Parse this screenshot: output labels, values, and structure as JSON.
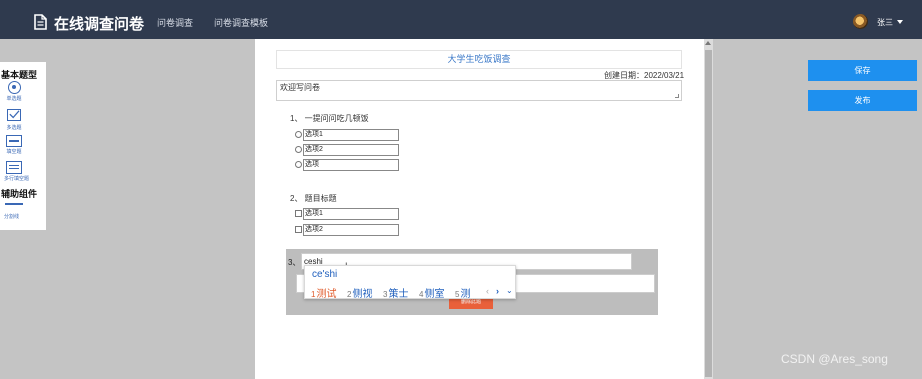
{
  "header": {
    "app_title": "在线调查问卷",
    "nav": [
      "问卷调查",
      "问卷调查模板"
    ],
    "user_name": "张三"
  },
  "palette": {
    "basic_heading": "基本题型",
    "tools": [
      "单选题",
      "多选题",
      "填空题",
      "多行填空题"
    ],
    "aux_heading": "辅助组件",
    "aux_tools": [
      "分割线"
    ]
  },
  "survey": {
    "title": "大学生吃饭调查",
    "create_date": "创建日期：2022/03/21",
    "welcome": "欢迎写问卷",
    "questions": [
      {
        "title": "1、 一提问问吃几顿饭",
        "options": [
          "选项1",
          "选项2",
          "选项"
        ]
      },
      {
        "title": "2、 题目标题",
        "options": [
          "选项1",
          "选项2"
        ]
      },
      {
        "number": "3、",
        "input_value": "ceshi",
        "delete_label": "删除此题"
      }
    ]
  },
  "ime": {
    "pinyin": "ce'shi",
    "candidates": [
      {
        "n": "1",
        "text": "测试"
      },
      {
        "n": "2",
        "text": "侧视"
      },
      {
        "n": "3",
        "text": "策士"
      },
      {
        "n": "4",
        "text": "侧室"
      },
      {
        "n": "5",
        "text": "测"
      }
    ],
    "prev": "‹",
    "next": "›",
    "expand": "⌄"
  },
  "actions": {
    "save": "保存",
    "publish": "发布"
  },
  "watermark": "CSDN @Ares_song",
  "colors": {
    "navbar": "#2f3a4e",
    "primary_button": "#1e90ef",
    "palette_icon": "#3a68b5",
    "delete_button": "#e9603a"
  }
}
